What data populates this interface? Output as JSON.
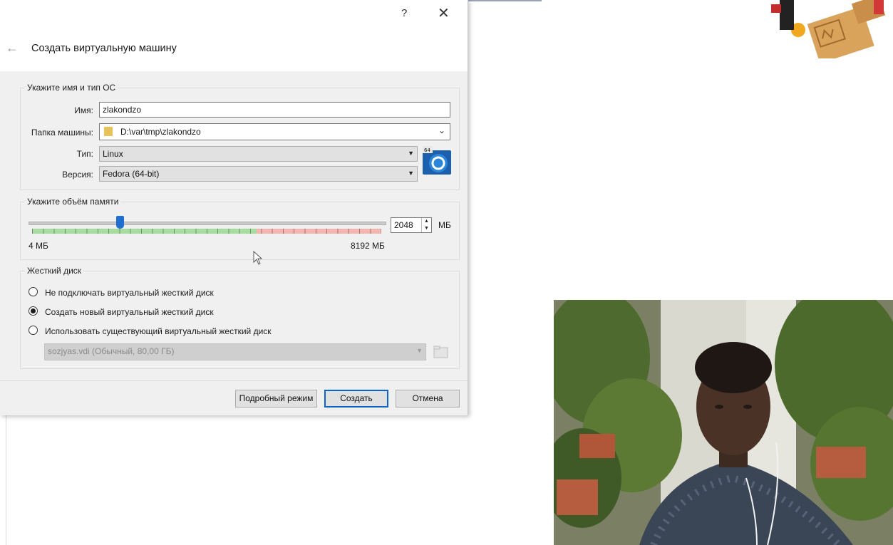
{
  "dialog": {
    "help_glyph": "?",
    "close_glyph": "✕",
    "back_glyph": "←",
    "title": "Создать виртуальную машину",
    "os_group": {
      "legend": "Укажите имя и тип ОС",
      "name_label": "Имя:",
      "name_value": "zlakondzo",
      "folder_label": "Папка машины:",
      "folder_value": "D:\\var\\tmp\\zlakondzo",
      "type_label": "Тип:",
      "type_value": "Linux",
      "version_label": "Версия:",
      "version_value": "Fedora (64-bit)",
      "os_icon": "fedora-64-icon"
    },
    "memory_group": {
      "legend": "Укажите объём памяти",
      "value": "2048",
      "unit": "МБ",
      "min_label": "4 МБ",
      "max_label": "8192 МБ",
      "fraction": 0.25
    },
    "disk_group": {
      "legend": "Жесткий диск",
      "options": [
        {
          "label": "Не подключать виртуальный жесткий диск",
          "checked": false
        },
        {
          "label": "Создать новый виртуальный жесткий диск",
          "checked": true
        },
        {
          "label": "Использовать существующий виртуальный жесткий диск",
          "checked": false
        }
      ],
      "existing_disk": "sozjyas.vdi (Обычный, 80,00 ГБ)"
    },
    "buttons": {
      "expert": "Подробный режим",
      "create": "Создать",
      "cancel": "Отмена"
    }
  },
  "colors": {
    "accent": "#0a63c8",
    "scale_green": "#a6dca0",
    "scale_red": "#f2b5b0"
  }
}
